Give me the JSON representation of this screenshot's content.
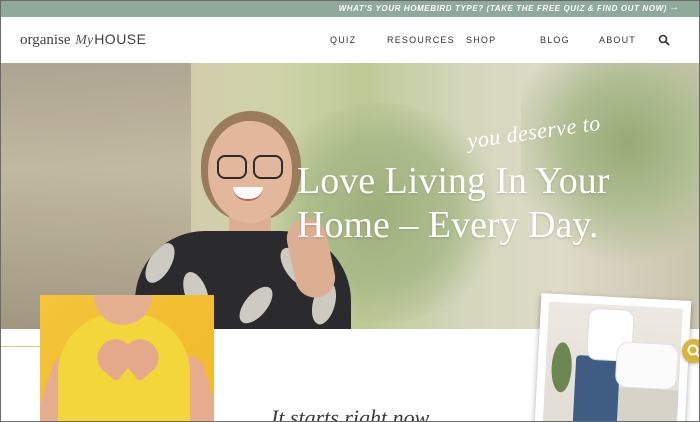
{
  "announcement": {
    "text": "WHAT'S YOUR HOMEBIRD TYPE? (TAKE THE FREE QUIZ & FIND OUT NOW)",
    "arrow_icon": "arrow-right-icon"
  },
  "header": {
    "logo": {
      "part1": "organise",
      "part2": "My",
      "part3": "HOUSE"
    },
    "nav": [
      "QUIZ",
      "RESOURCES",
      "SHOP",
      "BLOG",
      "ABOUT"
    ],
    "search_icon": "search-icon"
  },
  "hero": {
    "tagline": "you deserve to",
    "headline_line1": "Love Living In Your",
    "headline_line2": "Home – Every Day."
  },
  "lower": {
    "heading": "It starts right now"
  },
  "floating_button": {
    "icon": "search-icon"
  },
  "colors": {
    "announcement_bg": "#8fa99a",
    "accent_gold": "#d9b43b",
    "text_dark": "#333333"
  }
}
